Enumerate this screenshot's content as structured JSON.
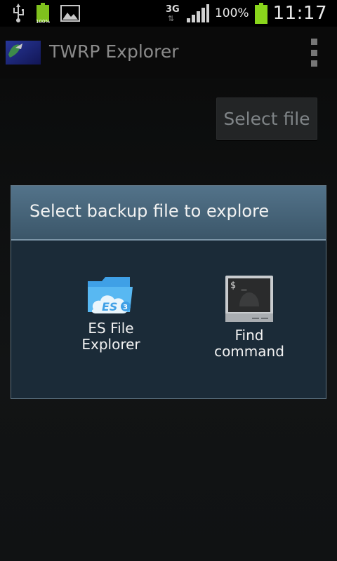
{
  "status_bar": {
    "network_type": "3G",
    "battery_percent": "100%",
    "mini_battery_percent": "100%",
    "time": "11:17",
    "icons": [
      "usb-icon",
      "battery-small-icon",
      "image-icon",
      "network-3g-icon",
      "signal-icon",
      "battery-icon"
    ]
  },
  "action_bar": {
    "title": "TWRP Explorer",
    "icon": "app-icon",
    "overflow_icon": "overflow-menu-icon"
  },
  "main": {
    "select_file_label": "Select file"
  },
  "dialog": {
    "title": "Select backup file to explore",
    "options": [
      {
        "label_line1": "ES File",
        "label_line2": "Explorer",
        "icon": "es-file-explorer-icon"
      },
      {
        "label_line1": "Find",
        "label_line2": "command",
        "icon": "terminal-icon"
      }
    ]
  },
  "colors": {
    "dialog_header": "#4a6a80",
    "dialog_body": "#1b2b38",
    "battery_green": "#8ad61c"
  }
}
